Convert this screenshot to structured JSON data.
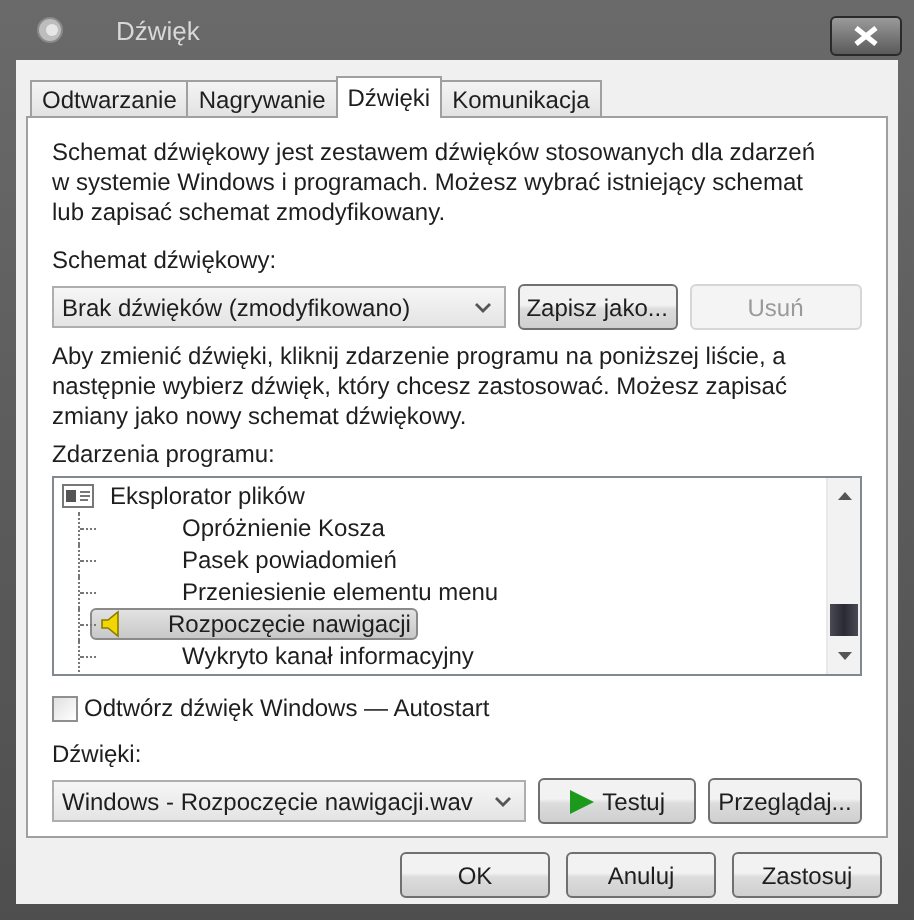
{
  "window": {
    "title": "Dźwięk"
  },
  "tabs": [
    {
      "label": "Odtwarzanie",
      "selected": false
    },
    {
      "label": "Nagrywanie",
      "selected": false
    },
    {
      "label": "Dźwięki",
      "selected": true
    },
    {
      "label": "Komunikacja",
      "selected": false
    }
  ],
  "description": "Schemat dźwiękowy jest zestawem dźwięków stosowanych dla zdarzeń w systemie Windows i programach. Możesz wybrać istniejący schemat lub zapisać schemat zmodyfikowany.",
  "scheme": {
    "label": "Schemat dźwiękowy:",
    "value": "Brak dźwięków (zmodyfikowano)"
  },
  "scheme_buttons": [
    {
      "label": "Zapisz jako...",
      "disabled": false
    },
    {
      "label": "Usuń",
      "disabled": true
    }
  ],
  "instructions": "Aby zmienić dźwięki, kliknij zdarzenie programu na poniższej liście, a następnie wybierz dźwięk, który chcesz zastosować. Możesz zapisać zmiany jako nowy schemat dźwiękowy.",
  "events": {
    "label": "Zdarzenia programu:",
    "items": [
      {
        "label": "Eksplorator plików",
        "children": [
          {
            "label": "Opróżnienie Kosza",
            "has_sound": false,
            "selected": false
          },
          {
            "label": "Pasek powiadomień",
            "has_sound": false,
            "selected": false
          },
          {
            "label": "Przeniesienie elementu menu",
            "has_sound": false,
            "selected": false
          },
          {
            "label": "Rozpoczęcie nawigacji",
            "has_sound": true,
            "selected": true
          },
          {
            "label": "Wykryto kanał informacyjny",
            "has_sound": false,
            "selected": false
          }
        ]
      }
    ]
  },
  "autostart": {
    "label": "Odtwórz dźwięk Windows — Autostart",
    "checked": false
  },
  "sounds": {
    "label": "Dźwięki:",
    "value": "Windows - Rozpoczęcie nawigacji.wav"
  },
  "sound_buttons": [
    {
      "kind": "play",
      "label": "Testuj"
    },
    {
      "kind": "plain",
      "label": "Przeglądaj..."
    }
  ],
  "footer_buttons": [
    {
      "label": "OK"
    },
    {
      "label": "Anuluj"
    },
    {
      "label": "Zastosuj"
    }
  ]
}
